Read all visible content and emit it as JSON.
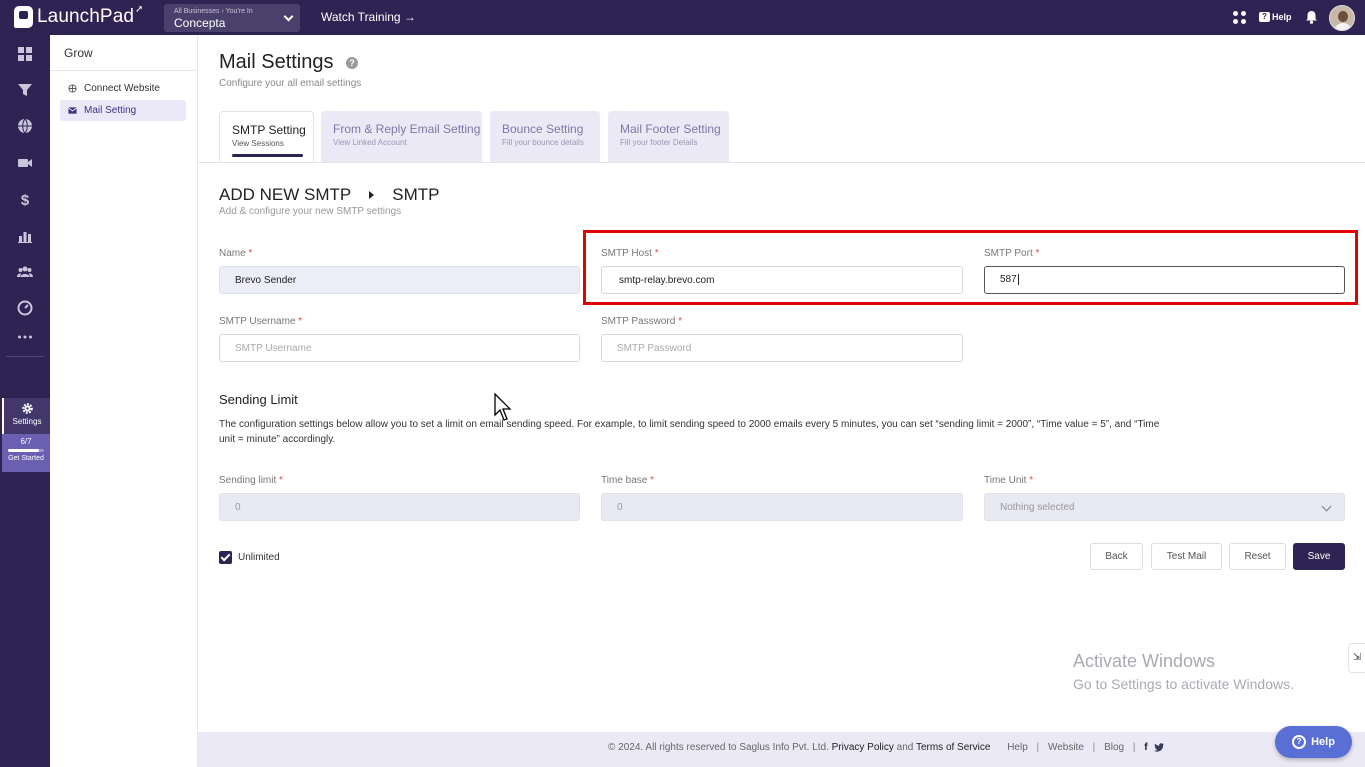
{
  "topbar": {
    "app_name": "LaunchPad",
    "business_caption": "All Businesses › You're In",
    "business_name": "Concepta",
    "watch_training": "Watch Training →",
    "help_label": "Help",
    "bg_color": "#2e2353"
  },
  "rail": {
    "items": [
      "dashboard-icon",
      "funnel-icon",
      "globe-icon",
      "video-icon",
      "dollar-icon",
      "chart-icon",
      "users-icon",
      "speed-icon",
      "more-icon"
    ],
    "settings_label": "Settings",
    "progress_text": "6/7",
    "progress_fraction": 0.86,
    "get_started_label": "Get Started"
  },
  "subnav": {
    "title": "Grow",
    "items": [
      {
        "label": "Connect Website",
        "icon": "web-icon",
        "active": false
      },
      {
        "label": "Mail Setting",
        "icon": "mail-icon",
        "active": true
      }
    ]
  },
  "page": {
    "title": "Mail Settings",
    "subtitle": "Configure your all email settings"
  },
  "tabs": [
    {
      "title": "SMTP Setting",
      "sub": "View Sessions",
      "active": true
    },
    {
      "title": "From & Reply Email Setting",
      "sub": "View Linked Account",
      "active": false
    },
    {
      "title": "Bounce Setting",
      "sub": "Fill your bounce details",
      "active": false
    },
    {
      "title": "Mail Footer Setting",
      "sub": "Fill your footer Details",
      "active": false
    }
  ],
  "section": {
    "crumb1": "ADD NEW SMTP",
    "crumb2": "SMTP",
    "subtitle": "Add & configure your new SMTP settings"
  },
  "form": {
    "name": {
      "label": "Name",
      "value": "Brevo Sender"
    },
    "smtp_host": {
      "label": "SMTP Host",
      "value": "smtp-relay.brevo.com"
    },
    "smtp_port": {
      "label": "SMTP Port",
      "value": "587"
    },
    "smtp_username": {
      "label": "SMTP Username",
      "placeholder": "SMTP Username"
    },
    "smtp_password": {
      "label": "SMTP Password",
      "placeholder": "SMTP Password"
    },
    "required_mark": "*"
  },
  "limit": {
    "title": "Sending Limit",
    "description": "The configuration settings below allow you to set a limit on email sending speed. For example, to limit sending speed to 2000 emails every 5 minutes, you can set “sending limit = 2000”, “Time value = 5”, and “Time unit = minute” accordingly.",
    "sending_limit": {
      "label": "Sending limit",
      "value": "0"
    },
    "time_base": {
      "label": "Time base",
      "value": "0"
    },
    "time_unit": {
      "label": "Time Unit",
      "value": "Nothing selected"
    },
    "unlimited_label": "Unlimited",
    "unlimited_checked": true
  },
  "buttons": {
    "back": "Back",
    "test_mail": "Test Mail",
    "reset": "Reset",
    "save": "Save"
  },
  "watermark": {
    "line1": "Activate Windows",
    "line2": "Go to Settings to activate Windows."
  },
  "footer": {
    "copyright": "©  2024. All rights reserved to Saglus Info Pvt. Ltd.",
    "privacy": "Privacy Policy",
    "and": "and",
    "terms": "Terms of Service",
    "help": "Help",
    "website": "Website",
    "blog": "Blog",
    "sep": "|",
    "facebook": "f"
  },
  "help_fab": "Help"
}
